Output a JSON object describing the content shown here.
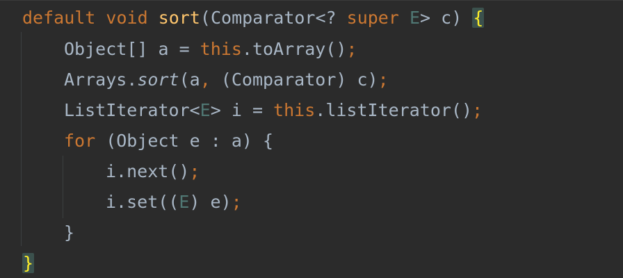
{
  "editor": {
    "language": "Java",
    "theme_colors": {
      "background": "#2b2b2b",
      "keyword": "#cc7832",
      "method_declaration": "#ffc66d",
      "type_parameter": "#507874",
      "default_text": "#a9b7c6",
      "matched_brace_background": "#3b514d"
    },
    "code": {
      "line1": {
        "kw_default": "default",
        "kw_void": "void",
        "method_name": "sort",
        "sig_part1": "(Comparator<?",
        "kw_super": "super",
        "type_e": "E",
        "sig_part2": "> c)",
        "open_brace": "{"
      },
      "line2": {
        "decl": "Object[] a = ",
        "kw_this": "this",
        "call": ".toArray()",
        "semicolon": ";"
      },
      "line3": {
        "class_name": "Arrays.",
        "static_method": "sort",
        "args_open": "(a",
        "comma": ",",
        "args_rest": " (Comparator) c)",
        "semicolon": ";"
      },
      "line4": {
        "type_start": "ListIterator<",
        "type_e": "E",
        "decl_rest": "> i = ",
        "kw_this": "this",
        "call": ".listIterator()",
        "semicolon": ";"
      },
      "line5": {
        "kw_for": "for",
        "loop_header": " (Object e : a) {"
      },
      "line6": {
        "call": "i.next()",
        "semicolon": ";"
      },
      "line7": {
        "call_start": "i.set((",
        "type_e": "E",
        "call_end": ") e)",
        "semicolon": ";"
      },
      "line8": {
        "close_brace": "}"
      },
      "line9": {
        "close_brace": "}"
      }
    }
  }
}
